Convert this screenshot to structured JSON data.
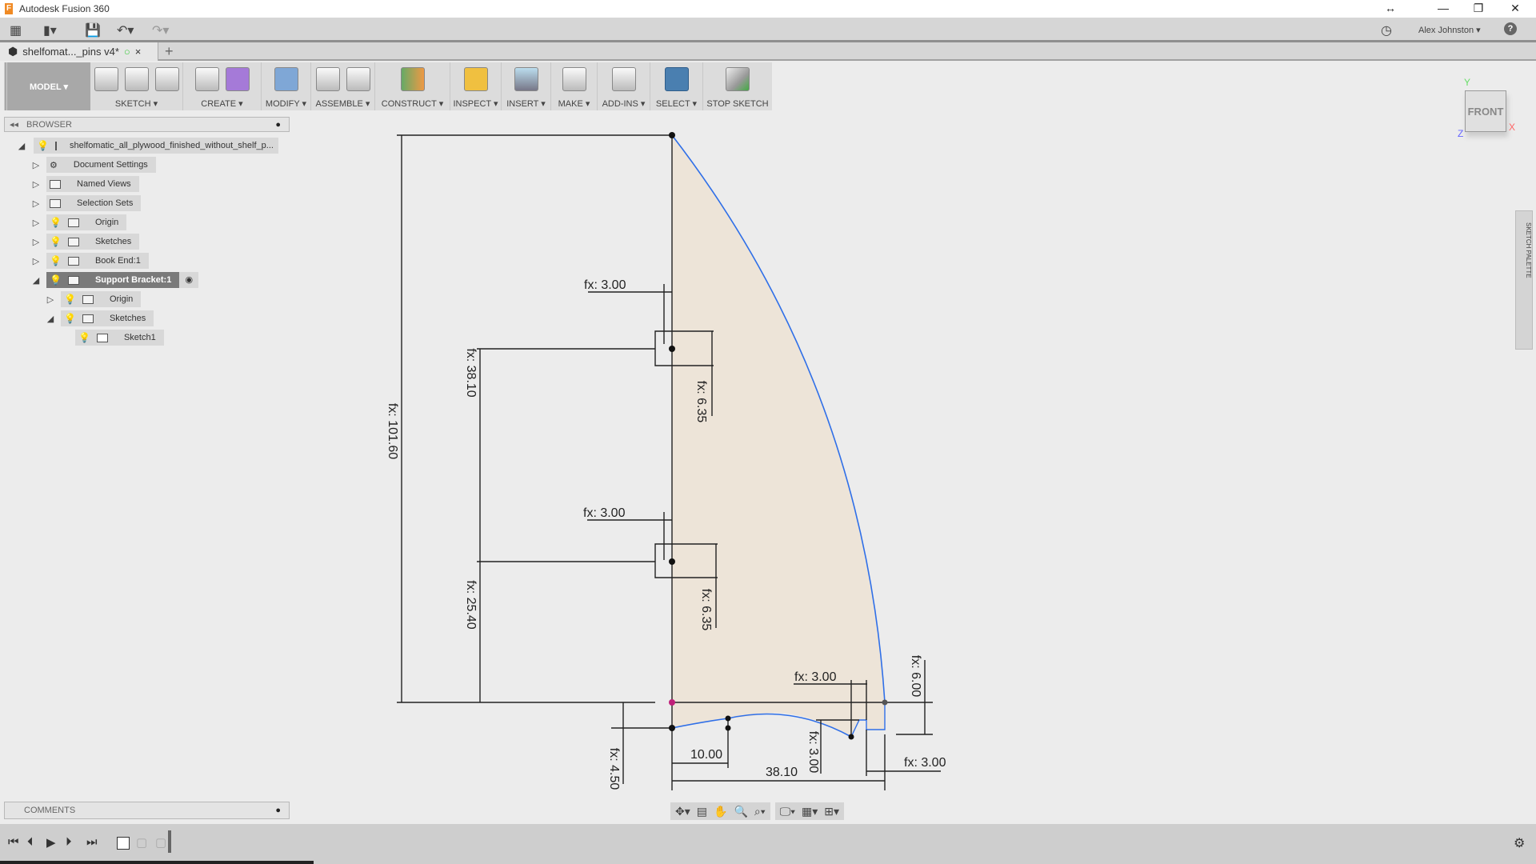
{
  "window": {
    "title": "Autodesk Fusion 360",
    "resize": "↔",
    "minimize": "—",
    "restore": "❐",
    "close": "✕"
  },
  "quickbar": {
    "user": "Alex Johnston ▾",
    "help": "?"
  },
  "doc_tab": {
    "label": "shelfomat..._pins v4*",
    "close": "×",
    "new": "+"
  },
  "ribbon": {
    "mode": "MODEL ▾",
    "groups": [
      "SKETCH ▾",
      "CREATE ▾",
      "MODIFY ▾",
      "ASSEMBLE ▾",
      "CONSTRUCT ▾",
      "INSPECT ▾",
      "INSERT ▾",
      "MAKE ▾",
      "ADD-INS ▾",
      "SELECT ▾",
      "STOP SKETCH"
    ]
  },
  "browser": {
    "title": "BROWSER",
    "items": [
      {
        "label": "shelfomatic_all_plywood_finished_without_shelf_p..."
      },
      {
        "label": "Document Settings"
      },
      {
        "label": "Named Views"
      },
      {
        "label": "Selection Sets"
      },
      {
        "label": "Origin"
      },
      {
        "label": "Sketches"
      },
      {
        "label": "Book End:1"
      },
      {
        "label": "Support Bracket:1"
      },
      {
        "label": "Origin"
      },
      {
        "label": "Sketches"
      },
      {
        "label": "Sketch1"
      }
    ]
  },
  "comments": {
    "title": "COMMENTS"
  },
  "viewcube": {
    "face": "FRONT",
    "x": "X",
    "y": "Y",
    "z": "Z"
  },
  "palette": {
    "label": "SKETCH PALETTE"
  },
  "sketch": {
    "fill": "#ede4d8",
    "curve_color": "#2f6fe8",
    "dims": {
      "overall_height": "fx: 101.60",
      "pin1_height": "fx: 38.10",
      "pin2_height": "fx: 25.40",
      "pin1_offset": "fx: 3.00",
      "pin1_width": "fx: 6.35",
      "pin2_offset": "fx: 3.00",
      "pin2_width": "fx: 6.35",
      "notch_offset": "fx: 3.00",
      "right_height": "fx: 6.00",
      "bottom_depth": "fx: 4.50",
      "curve_x": "10.00",
      "base_width": "38.10",
      "notch_depth": "fx: 3.00",
      "notch_width": "fx: 3.00"
    }
  }
}
